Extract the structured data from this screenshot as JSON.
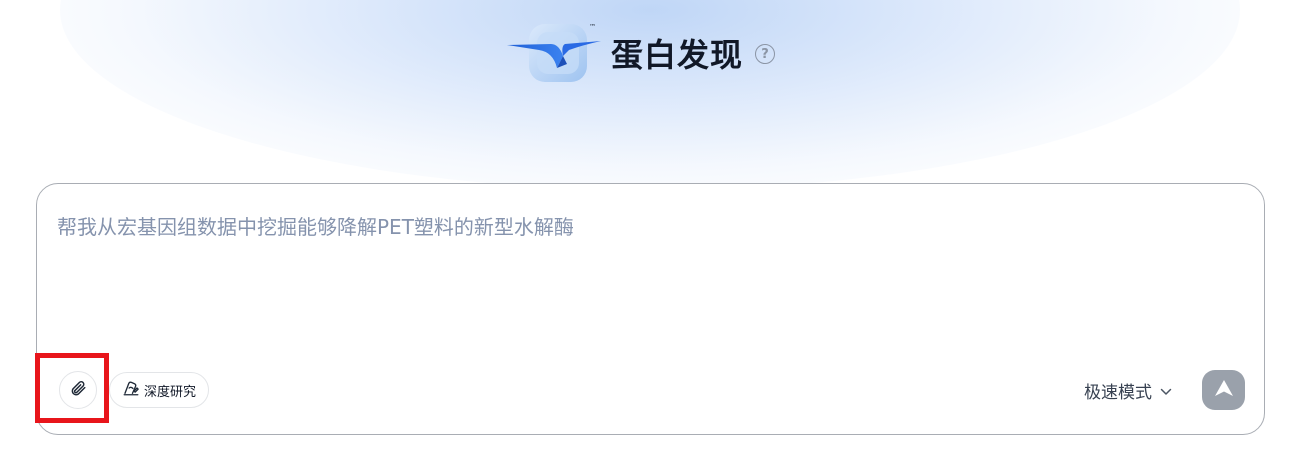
{
  "header": {
    "brand_title": "蛋白发现",
    "trademark": "™",
    "help_symbol": "?"
  },
  "composer": {
    "placeholder": "帮我从宏基因组数据中挖掘能够降解PET塑料的新型水解酶",
    "deep_research_label": "深度研究",
    "mode_label": "极速模式"
  },
  "icons": {
    "logo": "bird-logo-icon",
    "help": "help-circle-icon",
    "attach": "paperclip-icon",
    "deep_research": "brain-edit-icon",
    "mode_chevron": "chevron-down-icon",
    "send": "send-arrow-icon"
  },
  "colors": {
    "placeholder": "#8593ad",
    "send_button": "#9aa1ab",
    "highlight_box": "#e8151b",
    "brand_blue": "#2f6fe0"
  }
}
